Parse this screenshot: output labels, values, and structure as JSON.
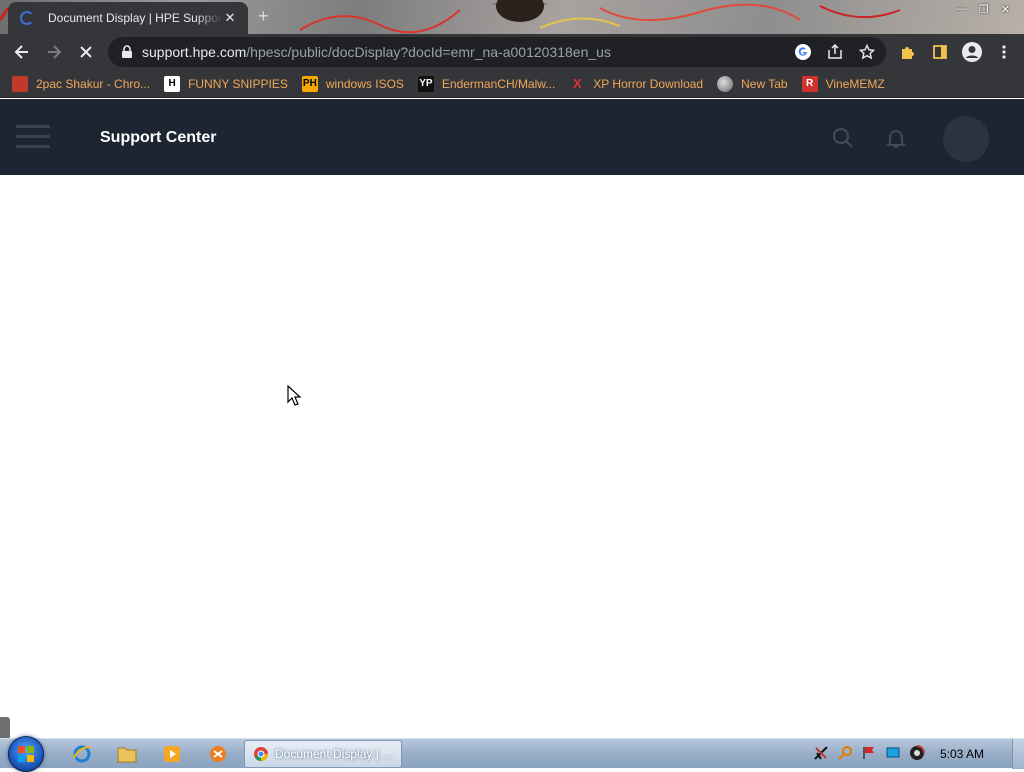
{
  "browser": {
    "tab": {
      "title": "Document Display | HPE Support",
      "close_glyph": "✕"
    },
    "new_tab_glyph": "+",
    "window_controls": {
      "minimize": "—",
      "restore": "❐",
      "close": "✕"
    },
    "address": {
      "host": "support.hpe.com",
      "path": "/hpesc/public/docDisplay?docId=emr_na-a00120318en_us"
    },
    "bookmarks": [
      {
        "label": "2pac Shakur - Chro...",
        "icon": "bookmark-icon-chrome-store",
        "fav_bg": "#c0392b",
        "fav_text": ""
      },
      {
        "label": "FUNNY SNIPPIES",
        "icon": "bookmark-icon-h",
        "fav_bg": "#ffffff",
        "fav_text": "H"
      },
      {
        "label": "windows ISOS",
        "icon": "bookmark-icon-ph",
        "fav_bg": "#f7a800",
        "fav_text": "PH"
      },
      {
        "label": "EndermanCH/Malw...",
        "icon": "bookmark-icon-yp",
        "fav_bg": "#111111",
        "fav_text": "YP"
      },
      {
        "label": "XP Horror Download",
        "icon": "bookmark-icon-x",
        "fav_bg": "transparent",
        "fav_text": "X"
      },
      {
        "label": "New Tab",
        "icon": "bookmark-icon-globe",
        "fav_bg": "#888888",
        "fav_text": ""
      },
      {
        "label": "VineMEMZ",
        "icon": "bookmark-icon-r",
        "fav_bg": "#d0322e",
        "fav_text": "R"
      }
    ]
  },
  "page": {
    "header": {
      "title": "Support Center"
    }
  },
  "taskbar": {
    "active_task_label": "Document Display | ...",
    "clock": "5:03 AM"
  },
  "colors": {
    "chrome_dark": "#35363a",
    "header_bg": "#1e2532",
    "bookmark_text": "#f0a75a"
  }
}
